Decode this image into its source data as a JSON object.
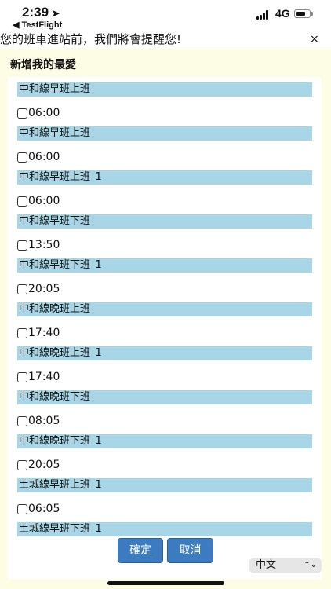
{
  "status_bar": {
    "time": "2:39",
    "back_app": "◀ TestFlight",
    "network": "4G"
  },
  "notice": {
    "text": "您的班車進站前，我們將會提醒您!",
    "close": "×"
  },
  "dialog": {
    "title": "新增我的最愛"
  },
  "routes": [
    {
      "name": "中和線早班上班",
      "time": "06:00"
    },
    {
      "name": "中和線早班上班",
      "time": "06:00"
    },
    {
      "name": "中和線早班上班–1",
      "time": "06:00"
    },
    {
      "name": "中和線早班下班",
      "time": "13:50"
    },
    {
      "name": "中和線早班下班–1",
      "time": "20:05"
    },
    {
      "name": "中和線晚班上班",
      "time": "17:40"
    },
    {
      "name": "中和線晚班上班–1",
      "time": "17:40"
    },
    {
      "name": "中和線晚班下班",
      "time": "08:05"
    },
    {
      "name": "中和線晚班下班–1",
      "time": "20:05"
    },
    {
      "name": "土城線早班上班–1",
      "time": "06:05"
    },
    {
      "name": "土城線早班下班–1",
      "time": ""
    }
  ],
  "buttons": {
    "confirm": "確定",
    "cancel": "取消"
  },
  "language": {
    "selected": "中文"
  }
}
